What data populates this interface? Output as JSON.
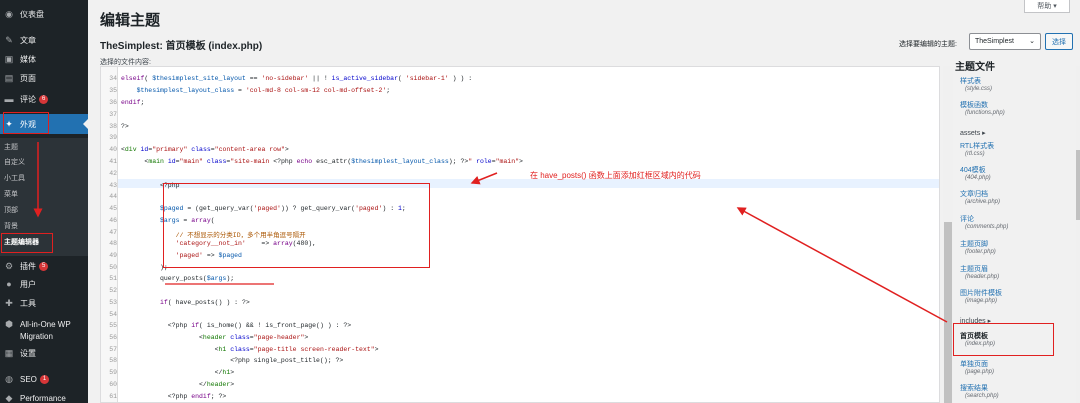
{
  "sidebar": {
    "items": [
      {
        "label": "仪表盘",
        "icon": "dashboard-icon"
      },
      {
        "label": "文章",
        "icon": "pin-icon"
      },
      {
        "label": "媒体",
        "icon": "media-icon"
      },
      {
        "label": "页面",
        "icon": "page-icon"
      },
      {
        "label": "评论",
        "icon": "comment-icon",
        "badge": "6"
      },
      {
        "label": "外观",
        "icon": "appearance-icon"
      },
      {
        "label": "插件",
        "icon": "plugin-icon",
        "badge": "5"
      },
      {
        "label": "用户",
        "icon": "user-icon"
      },
      {
        "label": "工具",
        "icon": "tools-icon"
      },
      {
        "label": "All-in-One WP",
        "icon": "migration-icon"
      },
      {
        "label": "Migration",
        "icon": ""
      },
      {
        "label": "设置",
        "icon": "settings-icon"
      },
      {
        "label": "SEO",
        "icon": "seo-icon",
        "badge": "1"
      },
      {
        "label": "Performance",
        "icon": "performance-icon"
      }
    ],
    "submenu": [
      "主题",
      "自定义",
      "小工具",
      "菜单",
      "顶部",
      "背景",
      "主题编辑器"
    ]
  },
  "header": {
    "title": "编辑主题",
    "help": "帮助 ▾",
    "file_heading": "TheSimplest: 首页模板 (index.php)",
    "content_label": "选择的文件内容:",
    "select_label": "选择要编辑的主题:",
    "selected_theme": "TheSimplest",
    "select_button": "选择"
  },
  "editor": {
    "line_numbers": [
      "34",
      "35",
      "36",
      "37",
      "38",
      "39",
      "40",
      "41",
      "42",
      "43",
      "44",
      "45",
      "46",
      "47",
      "48",
      "49",
      "50",
      "51",
      "52",
      "53",
      "54",
      "55",
      "56",
      "57",
      "58",
      "59",
      "60",
      "61",
      "62",
      "63",
      "64"
    ]
  },
  "annotation": {
    "text": "在 have_posts() 函数上面添加红框区域内的代码",
    "color": "#e02020"
  },
  "files": {
    "heading": "主题文件",
    "list": [
      {
        "name": "样式表",
        "path": "(style.css)"
      },
      {
        "name": "模板函数",
        "path": "(functions.php)"
      },
      {
        "name": "assets ▸",
        "path": ""
      },
      {
        "name": "RTL样式表",
        "path": "(rtl.css)"
      },
      {
        "name": "404模板",
        "path": "(404.php)"
      },
      {
        "name": "文章归档",
        "path": "(archive.php)"
      },
      {
        "name": "评论",
        "path": "(comments.php)"
      },
      {
        "name": "主题页脚",
        "path": "(footer.php)"
      },
      {
        "name": "主题页眉",
        "path": "(header.php)"
      },
      {
        "name": "图片附件模板",
        "path": "(image.php)"
      },
      {
        "name": "includes ▸",
        "path": ""
      },
      {
        "name": "首页模板",
        "path": "(index.php)"
      },
      {
        "name": "单独页面",
        "path": "(page.php)"
      },
      {
        "name": "搜索结果",
        "path": "(search.php)"
      }
    ]
  },
  "colors": {
    "sidebar_bg": "#1d2327",
    "accent": "#2271b1",
    "annotation_red": "#e02020"
  }
}
